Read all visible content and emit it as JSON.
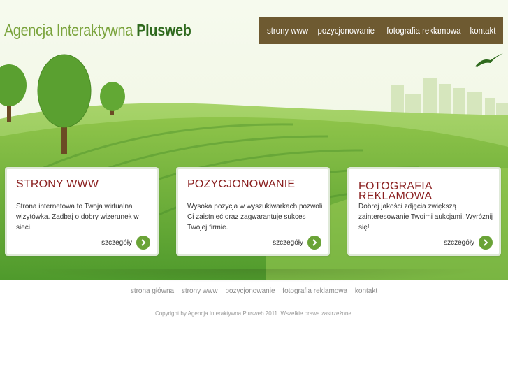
{
  "logo": {
    "light": "Agencja Interaktywna ",
    "strong": "Plusweb"
  },
  "topnav": [
    "strony www",
    "pozycjonowanie",
    "fotografia reklamowa",
    "kontakt"
  ],
  "cards": [
    {
      "title": "STRONY WWW",
      "text": "Strona internetowa to Twoja wirtualna wizytówka. Zadbaj o dobry wizerunek w sieci.",
      "more": "szczegóły"
    },
    {
      "title": "POZYCJONOWANIE",
      "text": "Wysoka pozycja w wyszukiwarkach pozwoli Ci zaistnieć oraz zagwarantuje sukces Twojej firmie.",
      "more": "szczegóły"
    },
    {
      "title": "FOTOGRAFIA REKLAMOWA",
      "text": "Dobrej jakości zdjęcia zwiększą zainteresowanie Twoimi aukcjami. Wyróżnij się!",
      "more": "szczegóły"
    }
  ],
  "footnav": [
    "strona główna",
    "strony www",
    "pozycjonowanie",
    "fotografia reklamowa",
    "kontakt"
  ],
  "copyright": "Copyright by Agencja Interaktywna Plusweb 2011. Wszelkie prawa zastrzeżone.",
  "colors": {
    "nav_bg": "#6e5a31",
    "title_red": "#8a1f1f",
    "green": "#6aa337"
  }
}
